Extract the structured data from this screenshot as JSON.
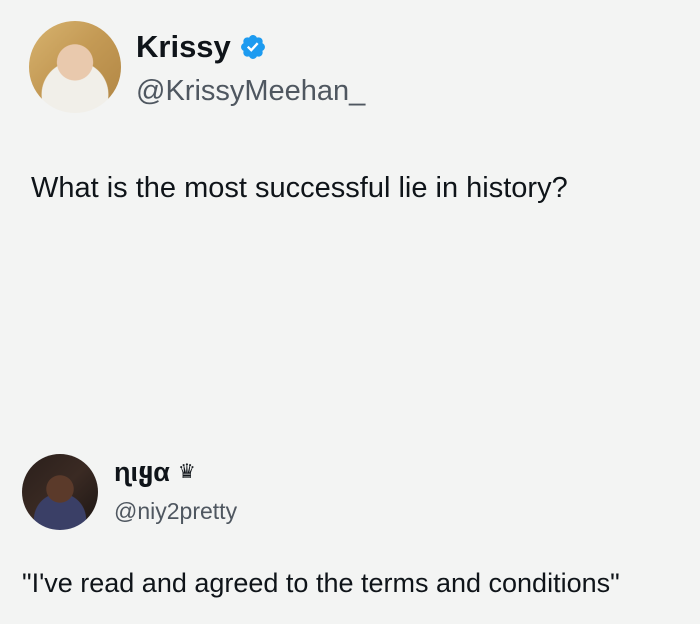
{
  "posts": [
    {
      "display_name": "Krissy",
      "handle": "@KrissyMeehan_",
      "text": "What is the most successful lie in history?",
      "verified": true,
      "accent": "#1d9bf0"
    },
    {
      "display_name": "ɳιყα",
      "handle": "@niy2pretty",
      "text": "\"I've read and agreed to the terms and conditions\"",
      "badge_icon": "crown-icon",
      "badge_glyph": "♛"
    }
  ]
}
